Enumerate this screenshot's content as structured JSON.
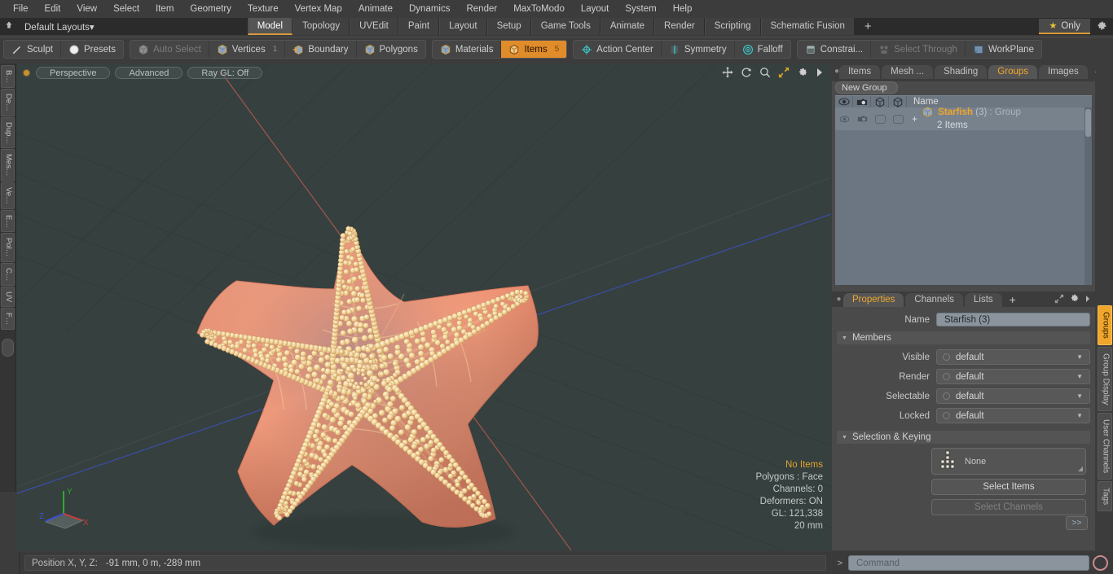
{
  "app": {
    "title": "Modo 3D Modeling Application"
  },
  "menubar": {
    "items": [
      "File",
      "Edit",
      "View",
      "Select",
      "Item",
      "Geometry",
      "Texture",
      "Vertex Map",
      "Animate",
      "Dynamics",
      "Render",
      "MaxToModo",
      "Layout",
      "System",
      "Help"
    ]
  },
  "layoutbar": {
    "home_icon": "home-icon",
    "layout_selector": "Default Layouts",
    "layout_caret": "▾",
    "tabs": [
      {
        "label": "Model",
        "active": true
      },
      {
        "label": "Topology",
        "active": false
      },
      {
        "label": "UVEdit",
        "active": false
      },
      {
        "label": "Paint",
        "active": false
      },
      {
        "label": "Layout",
        "active": false
      },
      {
        "label": "Setup",
        "active": false
      },
      {
        "label": "Game Tools",
        "active": false
      },
      {
        "label": "Animate",
        "active": false
      },
      {
        "label": "Render",
        "active": false
      },
      {
        "label": "Scripting",
        "active": false
      },
      {
        "label": "Schematic Fusion",
        "active": false
      }
    ],
    "add_tab": "+",
    "only_label": "Only",
    "only_star": "★",
    "gear_icon": "gear-icon"
  },
  "modebar": {
    "group1": [
      {
        "label": "Sculpt",
        "icon": "brush-icon",
        "state": "normal"
      },
      {
        "label": "Presets",
        "icon": "sphere-icon",
        "state": "normal"
      }
    ],
    "group2": [
      {
        "label": "Auto Select",
        "icon": "cube-grey-icon",
        "state": "dim",
        "count": ""
      },
      {
        "label": "Vertices",
        "icon": "cube-blue-icon",
        "state": "normal",
        "count": "1"
      },
      {
        "label": "Boundary",
        "icon": "cube-arrow-icon",
        "state": "normal",
        "count": ""
      },
      {
        "label": "Polygons",
        "icon": "cube-blue-icon",
        "state": "normal",
        "count": ""
      }
    ],
    "group3": [
      {
        "label": "Materials",
        "icon": "cube-blue-icon",
        "state": "normal",
        "count": ""
      },
      {
        "label": "Items",
        "icon": "cube-orange-icon",
        "state": "on",
        "count": "5"
      }
    ],
    "group4": [
      {
        "label": "Action Center",
        "icon": "crosshair-icon",
        "state": "normal"
      },
      {
        "label": "Symmetry",
        "icon": "symmetry-icon",
        "state": "normal"
      },
      {
        "label": "Falloff",
        "icon": "falloff-icon",
        "state": "normal"
      }
    ],
    "group5": [
      {
        "label": "Constrai...",
        "icon": "constraint-icon",
        "state": "normal"
      },
      {
        "label": "Select Through",
        "icon": "select-through-icon",
        "state": "dim"
      },
      {
        "label": "WorkPlane",
        "icon": "workplane-icon",
        "state": "normal"
      }
    ]
  },
  "left_strip": {
    "tabs": [
      "B…",
      "De…",
      "Dup…",
      "Mes…",
      "Ve…",
      "E…",
      "Pol…",
      "C…",
      "UV",
      "F…"
    ]
  },
  "viewport": {
    "dot": "view-indicator",
    "buttons": [
      "Perspective",
      "Advanced",
      "Ray GL: Off"
    ],
    "tools": [
      "move-icon",
      "rotate-icon",
      "zoom-icon",
      "fit-icon",
      "gear-icon",
      "play-icon"
    ],
    "model_name": "starfish-3d-model",
    "axis_gizmo": {
      "x": "X",
      "y": "Y",
      "z": "Z"
    },
    "stats": {
      "selection": "No Items",
      "polygons": "Polygons : Face",
      "channels": "Channels: 0",
      "deformers": "Deformers: ON",
      "gl": "GL: 121,338",
      "scale": "20 mm"
    }
  },
  "statusbar": {
    "position_label": "Position X, Y, Z:",
    "position_value": "-91 mm, 0 m, -289 mm"
  },
  "right_panel": {
    "tabs": [
      {
        "label": "Items",
        "active": false
      },
      {
        "label": "Mesh ...",
        "active": false
      },
      {
        "label": "Shading",
        "active": false
      },
      {
        "label": "Groups",
        "active": true
      },
      {
        "label": "Images",
        "active": false
      }
    ],
    "add_tab": "+",
    "tools": [
      "expand-icon",
      "chevron-right-icon"
    ],
    "new_group_button": "New Group",
    "list_headers": {
      "eye": "visibility-icon",
      "render": "render-icon",
      "cube1": "cube-outline-icon",
      "cube2": "cube-outline-icon",
      "name": "Name"
    },
    "rows": [
      {
        "expander": "+",
        "icon": "group-cube-icon",
        "name": "Starfish",
        "count": "(3)",
        "type": ": Group",
        "sub": "2 Items"
      }
    ]
  },
  "properties": {
    "tabs": [
      {
        "label": "Properties",
        "active": true
      },
      {
        "label": "Channels",
        "active": false
      },
      {
        "label": "Lists",
        "active": false
      }
    ],
    "add_tab": "+",
    "tools": [
      "expand-icon",
      "gear-icon",
      "chevron-right-icon"
    ],
    "name_label": "Name",
    "name_value": "Starfish (3)",
    "members_section": "Members",
    "fields": [
      {
        "label": "Visible",
        "value": "default"
      },
      {
        "label": "Render",
        "value": "default"
      },
      {
        "label": "Selectable",
        "value": "default"
      },
      {
        "label": "Locked",
        "value": "default"
      }
    ],
    "keying_section": "Selection & Keying",
    "keying_value": "None",
    "keying_icon": "keying-matrix-icon",
    "select_items_button": "Select Items",
    "select_channels_button": "Select Channels",
    "forward_button": ">>"
  },
  "right_strip": {
    "tabs": [
      {
        "label": "Groups",
        "active": true
      },
      {
        "label": "Group Display",
        "active": false
      },
      {
        "label": "User Channels",
        "active": false
      },
      {
        "label": "Tags",
        "active": false
      }
    ]
  },
  "command": {
    "prompt": ">",
    "placeholder": "Command",
    "record_icon": "record-icon"
  },
  "colors": {
    "accent": "#f0a62a",
    "viewport_bg": "#36403f",
    "panel_bg": "#4a4a4a",
    "list_bg": "#6b7682",
    "x_axis": "#b05a4e",
    "y_axis": "#4aa04a",
    "z_axis": "#4a5fc0",
    "starfish": "#f08a68"
  }
}
